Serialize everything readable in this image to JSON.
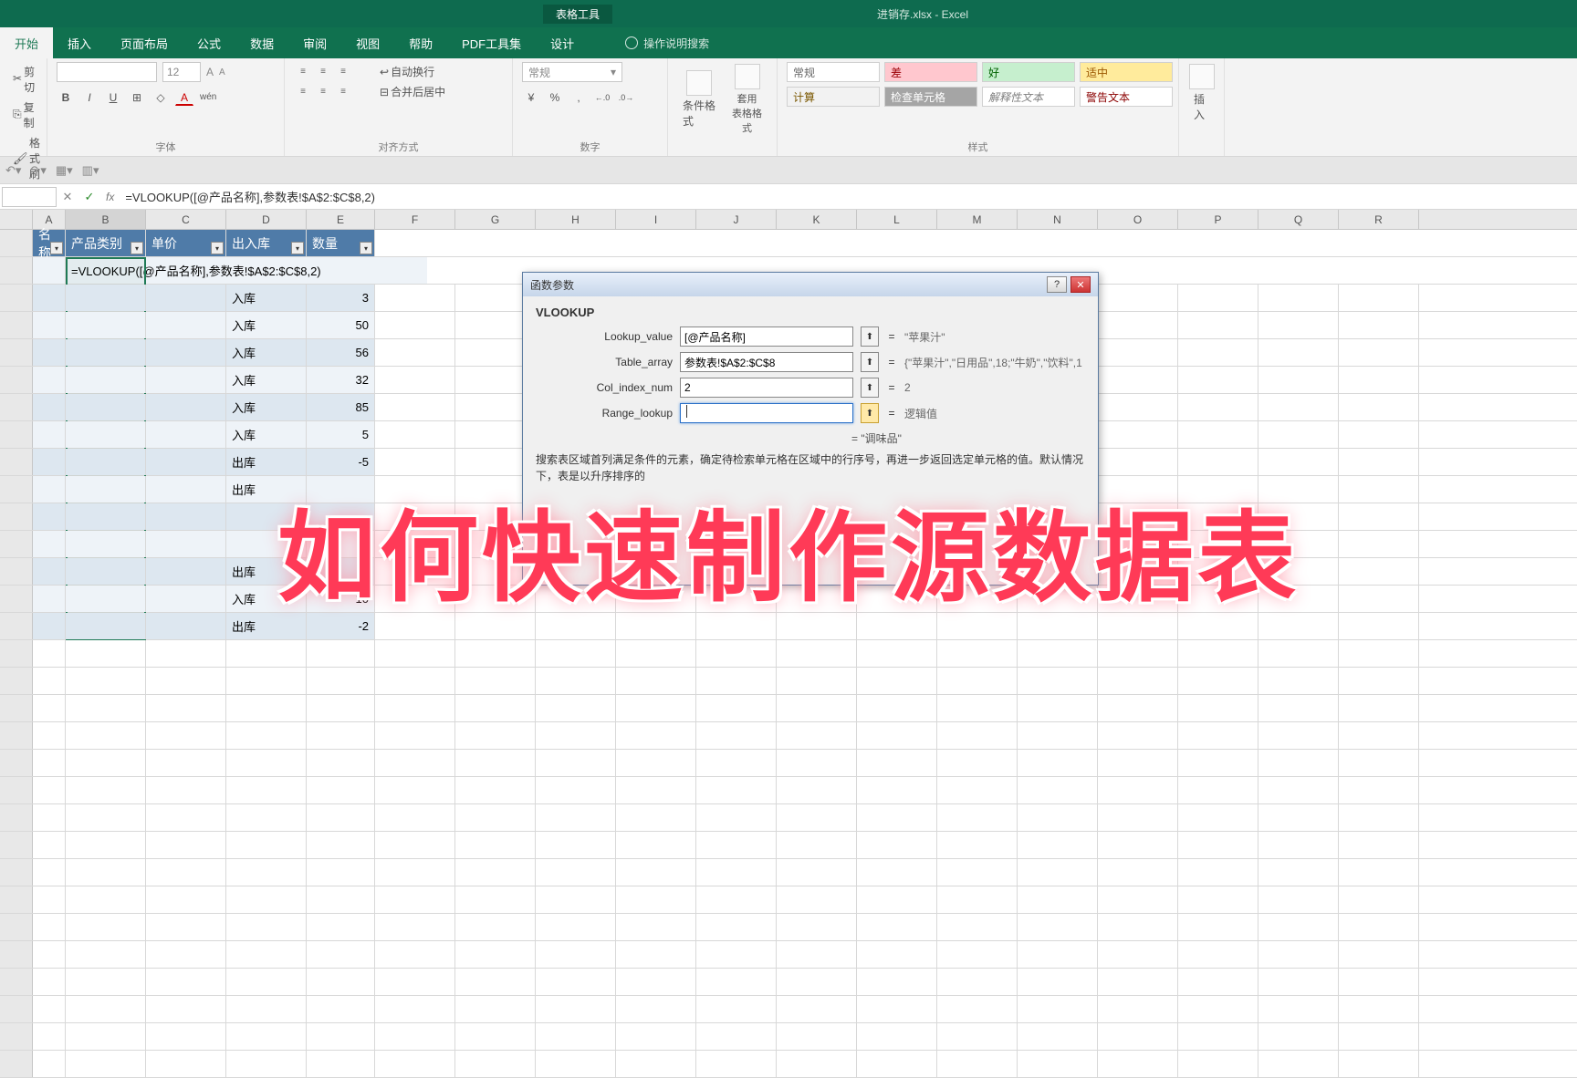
{
  "app": {
    "table_tools": "表格工具",
    "filename": "进销存.xlsx - Excel"
  },
  "ribbon_tabs": {
    "start": "开始",
    "insert": "插入",
    "layout": "页面布局",
    "formula": "公式",
    "data": "数据",
    "review": "审阅",
    "view": "视图",
    "help": "帮助",
    "pdf": "PDF工具集",
    "design": "设计",
    "tell_me": "操作说明搜索"
  },
  "ribbon": {
    "clipboard": {
      "cut": "剪切",
      "copy": "复制",
      "painter": "格式刷"
    },
    "font": {
      "label": "字体",
      "size": "12",
      "bold": "B",
      "italic": "I",
      "underline": "U",
      "border": "⊞",
      "fill": "◇",
      "color": "A",
      "wen": "wén"
    },
    "align": {
      "label": "对齐方式",
      "wrap": "自动换行",
      "merge": "合并后居中"
    },
    "number": {
      "label": "数字",
      "format": "常规",
      "pct": "%",
      "comma": ",",
      "dec_inc": "◀.0",
      "dec_dec": ".0▶"
    },
    "styles": {
      "label": "样式",
      "cond": "条件格式",
      "table": "套用\n表格格式",
      "normal": "常规",
      "bad": "差",
      "good": "好",
      "neutral": "适中",
      "calc": "计算",
      "check": "检查单元格",
      "explain": "解释性文本",
      "warn": "警告文本"
    },
    "insert_cell": "插入"
  },
  "formula_bar": {
    "name": "",
    "formula": "=VLOOKUP([@产品名称],参数表!$A$2:$C$8,2)"
  },
  "columns": [
    "A",
    "B",
    "C",
    "D",
    "E",
    "F",
    "G",
    "H",
    "I",
    "J",
    "K",
    "L",
    "M",
    "N",
    "O",
    "P",
    "Q",
    "R"
  ],
  "headers": {
    "a": "名称",
    "b": "产品类别",
    "c": "单价",
    "d": "出入库",
    "e": "数量"
  },
  "formula_cell": "=VLOOKUP([@产品名称],参数表!$A$2:$C$8,2)",
  "rows": [
    {
      "d": "入库",
      "e": "3"
    },
    {
      "d": "入库",
      "e": "50"
    },
    {
      "d": "入库",
      "e": "56"
    },
    {
      "d": "入库",
      "e": "32"
    },
    {
      "d": "入库",
      "e": "85"
    },
    {
      "d": "入库",
      "e": "5"
    },
    {
      "d": "出库",
      "e": "-5"
    },
    {
      "d": "出库",
      "e": ""
    },
    {
      "d": "",
      "e": ""
    },
    {
      "d": "",
      "e": ""
    },
    {
      "d": "出库",
      "e": ""
    },
    {
      "d": "入库",
      "e": "10"
    },
    {
      "d": "出库",
      "e": "-2"
    }
  ],
  "dialog": {
    "title": "函数参数",
    "func": "VLOOKUP",
    "args": {
      "lookup_value": {
        "label": "Lookup_value",
        "val": "[@产品名称]",
        "res": "\"苹果汁\""
      },
      "table_array": {
        "label": "Table_array",
        "val": "参数表!$A$2:$C$8",
        "res": "{\"苹果汁\",\"日用品\",18;\"牛奶\",\"饮料\",1"
      },
      "col_index": {
        "label": "Col_index_num",
        "val": "2",
        "res": "2"
      },
      "range_lookup": {
        "label": "Range_lookup",
        "val": "",
        "res": "逻辑值"
      }
    },
    "result_eq": "= \"调味品\"",
    "desc": "搜索表区域首列满足条件的元素，确定待检索单元格在区域中的行序号，再进一步返回选定单元格的值。默认情况下，表是以升序排序的"
  },
  "overlay": "如何快速制作源数据表"
}
